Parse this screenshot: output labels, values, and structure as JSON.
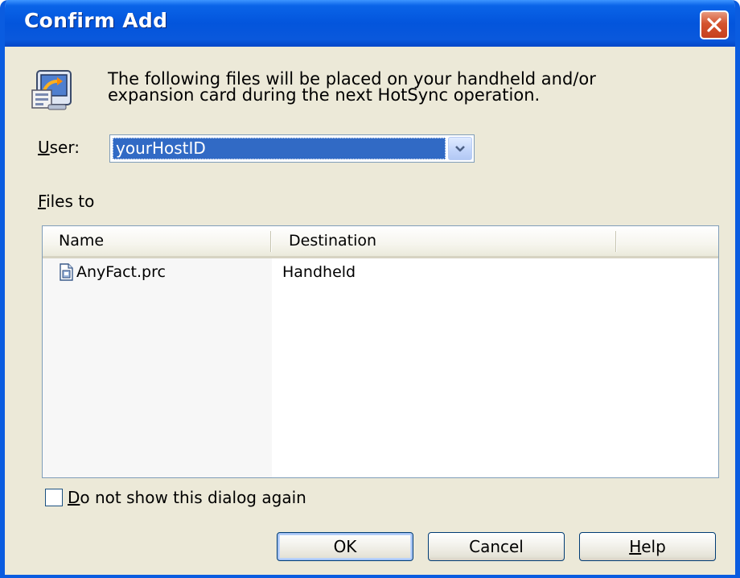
{
  "window": {
    "title": "Confirm Add"
  },
  "message": {
    "line1": "The following files will be placed on your handheld and/or",
    "line2": "expansion card during the next HotSync operation."
  },
  "user": {
    "label_mnemonic": "U",
    "label_rest": "ser:",
    "selected_value": "yourHostID"
  },
  "files": {
    "label_mnemonic": "F",
    "label_rest": "iles to",
    "columns": [
      "Name",
      "Destination"
    ],
    "rows": [
      {
        "name": "AnyFact.prc",
        "destination": "Handheld",
        "icon": "prc-file-icon"
      }
    ]
  },
  "options": {
    "dont_show_mnemonic": "D",
    "dont_show_rest": "o not show this dialog again",
    "dont_show_checked": false
  },
  "buttons": {
    "ok": "OK",
    "cancel": "Cancel",
    "help_mnemonic": "H",
    "help_rest": "elp"
  },
  "colors": {
    "titlebar": "#0355dc",
    "dialog_bg": "#ece9d8",
    "selection": "#316ac5",
    "close_button": "#c6401e"
  }
}
